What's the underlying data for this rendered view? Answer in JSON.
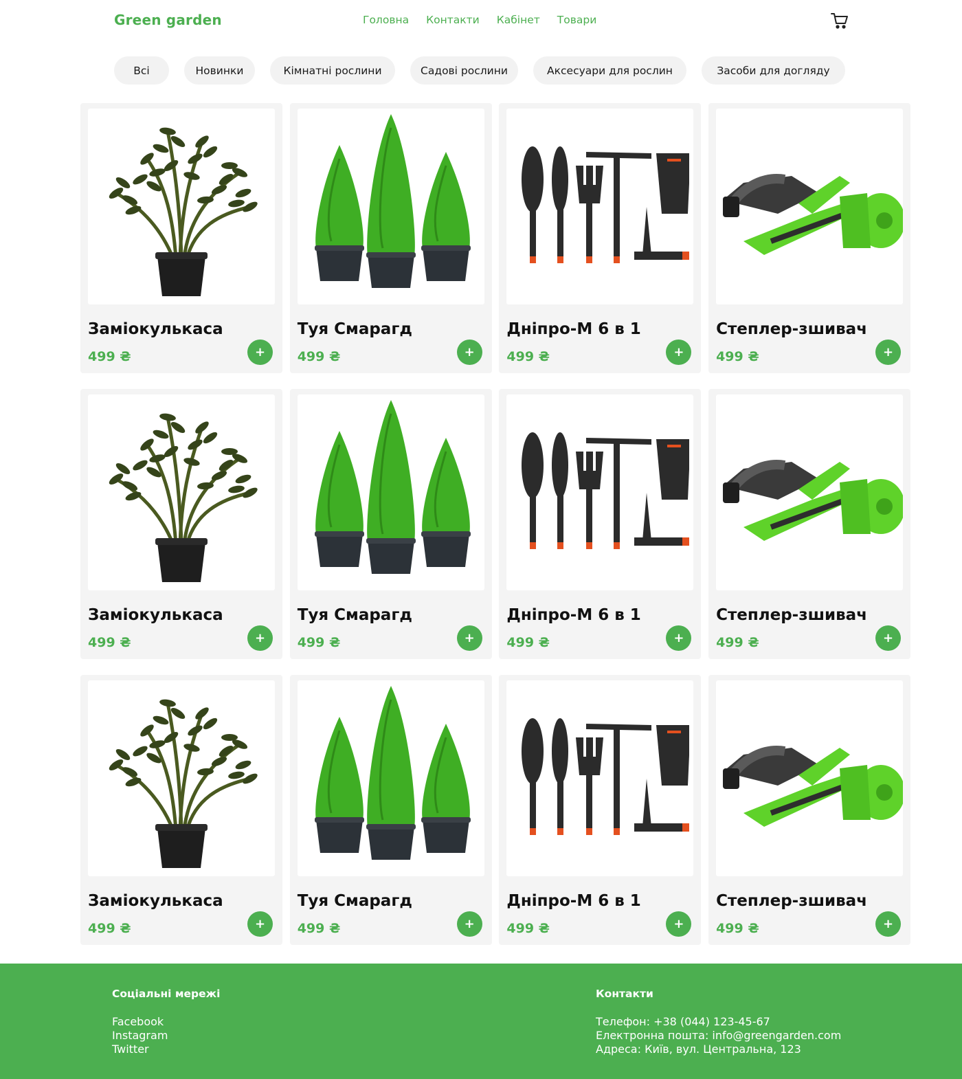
{
  "header": {
    "logo": "Green garden",
    "nav": [
      "Головна",
      "Контакти",
      "Кабінет",
      "Товари"
    ],
    "cart_icon": "cart-icon"
  },
  "categories": [
    "Всі",
    "Новинки",
    "Кімнатні рослини",
    "Садові рослини",
    "Аксесуари для рослин",
    "Засоби для догляду"
  ],
  "products": [
    {
      "name": "Заміокулькаса",
      "price": "499 ₴",
      "image": "zamioculcas-plant"
    },
    {
      "name": "Туя Смарагд",
      "price": "499 ₴",
      "image": "thuja-smaragd-trees"
    },
    {
      "name": "Дніпро-М 6 в 1",
      "price": "499 ₴",
      "image": "garden-tool-set"
    },
    {
      "name": "Степлер-зшивач",
      "price": "499 ₴",
      "image": "tapetool-stapler"
    },
    {
      "name": "Заміокулькаса",
      "price": "499 ₴",
      "image": "zamioculcas-plant"
    },
    {
      "name": "Туя Смарагд",
      "price": "499 ₴",
      "image": "thuja-smaragd-trees"
    },
    {
      "name": "Дніпро-М 6 в 1",
      "price": "499 ₴",
      "image": "garden-tool-set"
    },
    {
      "name": "Степлер-зшивач",
      "price": "499 ₴",
      "image": "tapetool-stapler"
    },
    {
      "name": "Заміокулькаса",
      "price": "499 ₴",
      "image": "zamioculcas-plant"
    },
    {
      "name": "Туя Смарагд",
      "price": "499 ₴",
      "image": "thuja-smaragd-trees"
    },
    {
      "name": "Дніпро-М 6 в 1",
      "price": "499 ₴",
      "image": "garden-tool-set"
    },
    {
      "name": "Степлер-зшивач",
      "price": "499 ₴",
      "image": "tapetool-stapler"
    }
  ],
  "add_button_label": "+",
  "footer": {
    "social_title": "Соціальні мережі",
    "social_links": [
      "Facebook",
      "Instagram",
      "Twitter"
    ],
    "contacts_title": "Контакти",
    "phone": "Телефон: +38 (044) 123-45-67",
    "email": "Електронна пошта: info@greengarden.com",
    "address": "Адреса: Київ, вул. Центральна, 123"
  },
  "colors": {
    "accent": "#4caf50",
    "card_bg": "#f4f4f4",
    "chip_bg": "#f2f2f2"
  }
}
